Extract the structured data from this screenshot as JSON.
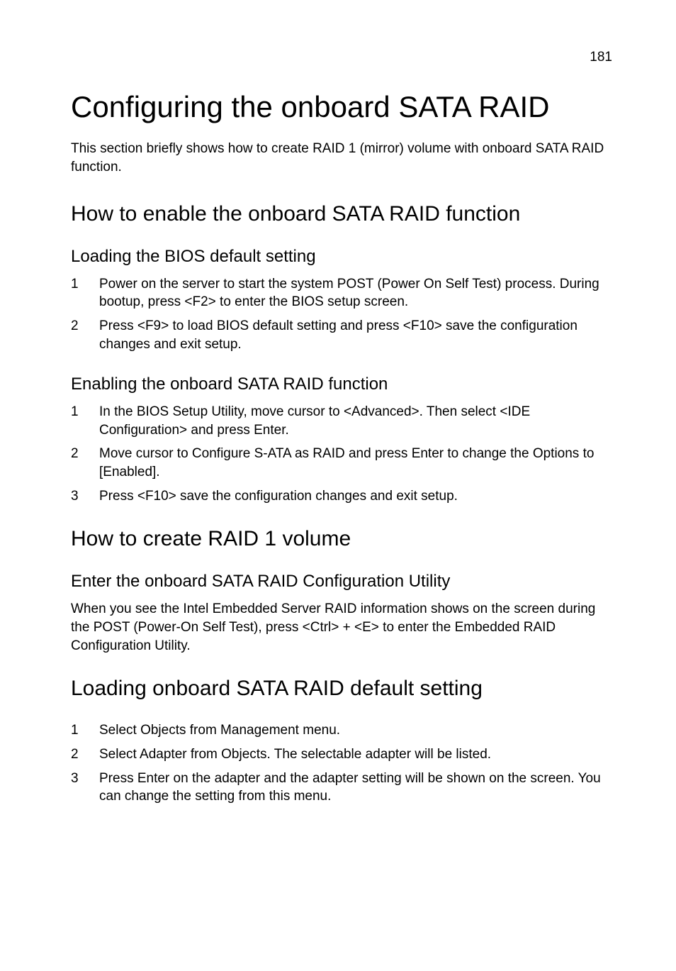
{
  "pageNumber": "181",
  "title": "Configuring the onboard SATA RAID",
  "intro": "This section briefly shows how to create RAID 1 (mirror) volume with onboard SATA RAID function.",
  "section1": {
    "heading": "How to enable the onboard SATA RAID function",
    "sub1": {
      "heading": "Loading the BIOS default setting",
      "items": [
        {
          "num": "1",
          "text": "Power on the server to start the system POST (Power On Self Test) process. During bootup, press <F2> to enter the BIOS setup screen."
        },
        {
          "num": "2",
          "text": "Press <F9> to load BIOS default setting and press <F10> save the configuration changes and exit setup."
        }
      ]
    },
    "sub2": {
      "heading": "Enabling the onboard SATA RAID function",
      "items": [
        {
          "num": "1",
          "text": "In the BIOS Setup Utility, move cursor to <Advanced>. Then select <IDE Configuration> and press Enter."
        },
        {
          "num": "2",
          "text": "Move cursor to Configure S-ATA as RAID and press Enter to change the Options to [Enabled]."
        },
        {
          "num": "3",
          "text": "Press <F10> save the configuration changes and exit setup."
        }
      ]
    }
  },
  "section2": {
    "heading": "How to create RAID 1 volume",
    "sub1": {
      "heading": "Enter the onboard SATA RAID Configuration Utility",
      "body": "When you see the Intel Embedded Server RAID information shows on the screen during the POST (Power-On Self Test), press <Ctrl> + <E> to enter the Embedded RAID Configuration Utility."
    }
  },
  "section3": {
    "heading": "Loading onboard SATA RAID default setting",
    "items": [
      {
        "num": "1",
        "text": "Select Objects from Management menu."
      },
      {
        "num": "2",
        "text": "Select Adapter from Objects. The selectable adapter will be listed."
      },
      {
        "num": "3",
        "text": "Press Enter on the adapter and the adapter setting will be shown on the screen. You can change the setting from this menu."
      }
    ]
  }
}
